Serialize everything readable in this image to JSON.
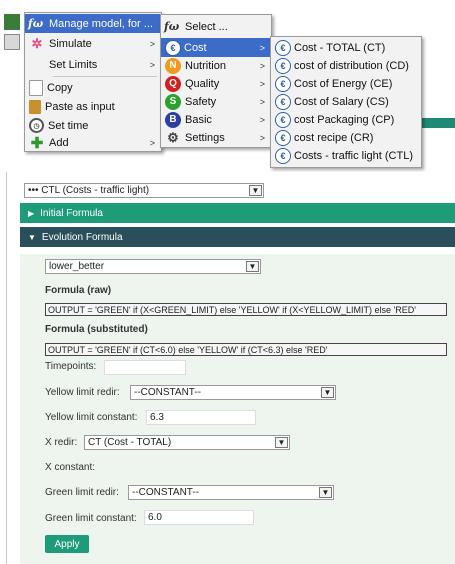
{
  "context_menu": {
    "items": [
      {
        "label": "Manage model, for ...",
        "icon": "fx-icon"
      },
      {
        "label": "Simulate",
        "icon": "simulate-icon"
      },
      {
        "label": "Set Limits",
        "icon": ""
      },
      {
        "label": "Copy",
        "icon": "copy-icon"
      },
      {
        "label": "Paste as input",
        "icon": "paste-icon"
      },
      {
        "label": "Set time",
        "icon": "clock-icon"
      },
      {
        "label": "Add",
        "icon": "add-icon"
      }
    ]
  },
  "submenu": {
    "items": [
      {
        "label": "Select ...",
        "icon": "fx-icon",
        "badge": ""
      },
      {
        "label": "Cost",
        "icon": "cost-icon",
        "badge": "€"
      },
      {
        "label": "Nutrition",
        "icon": "nutrition-icon",
        "badge": "N",
        "color": "#f39a1e"
      },
      {
        "label": "Quality",
        "icon": "quality-icon",
        "badge": "Q",
        "color": "#d21f1f"
      },
      {
        "label": "Safety",
        "icon": "safety-icon",
        "badge": "S",
        "color": "#2aa12e"
      },
      {
        "label": "Basic",
        "icon": "basic-icon",
        "badge": "B",
        "color": "#2a3f9e"
      },
      {
        "label": "Settings",
        "icon": "gear-icon",
        "badge": ""
      }
    ]
  },
  "cost_menu": {
    "badge": "€",
    "items": [
      "Cost - TOTAL (CT)",
      "cost of distribution (CD)",
      "Cost of Energy (CE)",
      "Cost of Salary (CS)",
      "cost Packaging (CP)",
      "cost recipe (CR)",
      "Costs - traffic light (CTL)"
    ]
  },
  "form": {
    "model_select": "••• CTL (Costs - traffic light)",
    "sections": {
      "initial": "Initial Formula",
      "evolution": "Evolution Formula"
    },
    "strategy_select": "lower_better",
    "formula_raw_label": "Formula (raw)",
    "formula_raw": "OUTPUT = 'GREEN' if (X<GREEN_LIMIT) else 'YELLOW' if (X<YELLOW_LIMIT) else 'RED'",
    "formula_sub_label": "Formula (substituted)",
    "formula_sub": "OUTPUT = 'GREEN' if (CT<6.0) else 'YELLOW' if (CT<6.3) else 'RED'",
    "timepoints_label": "Timepoints:",
    "timepoints_value": "",
    "yellow_redir_label": "Yellow limit redir:",
    "yellow_redir_value": "--CONSTANT--",
    "yellow_const_label": "Yellow limit constant:",
    "yellow_const_value": "6.3",
    "x_redir_label": "X redir:",
    "x_redir_value": "CT (Cost - TOTAL)",
    "x_const_label": "X constant:",
    "x_const_value": "",
    "green_redir_label": "Green limit redir:",
    "green_redir_value": "--CONSTANT--",
    "green_const_label": "Green limit constant:",
    "green_const_value": "6.0",
    "apply_label": "Apply"
  },
  "colors": {
    "accent": "#1e9c7a",
    "section_dark": "#2a4f5a",
    "menu_highlight": "#3d6bc8"
  }
}
